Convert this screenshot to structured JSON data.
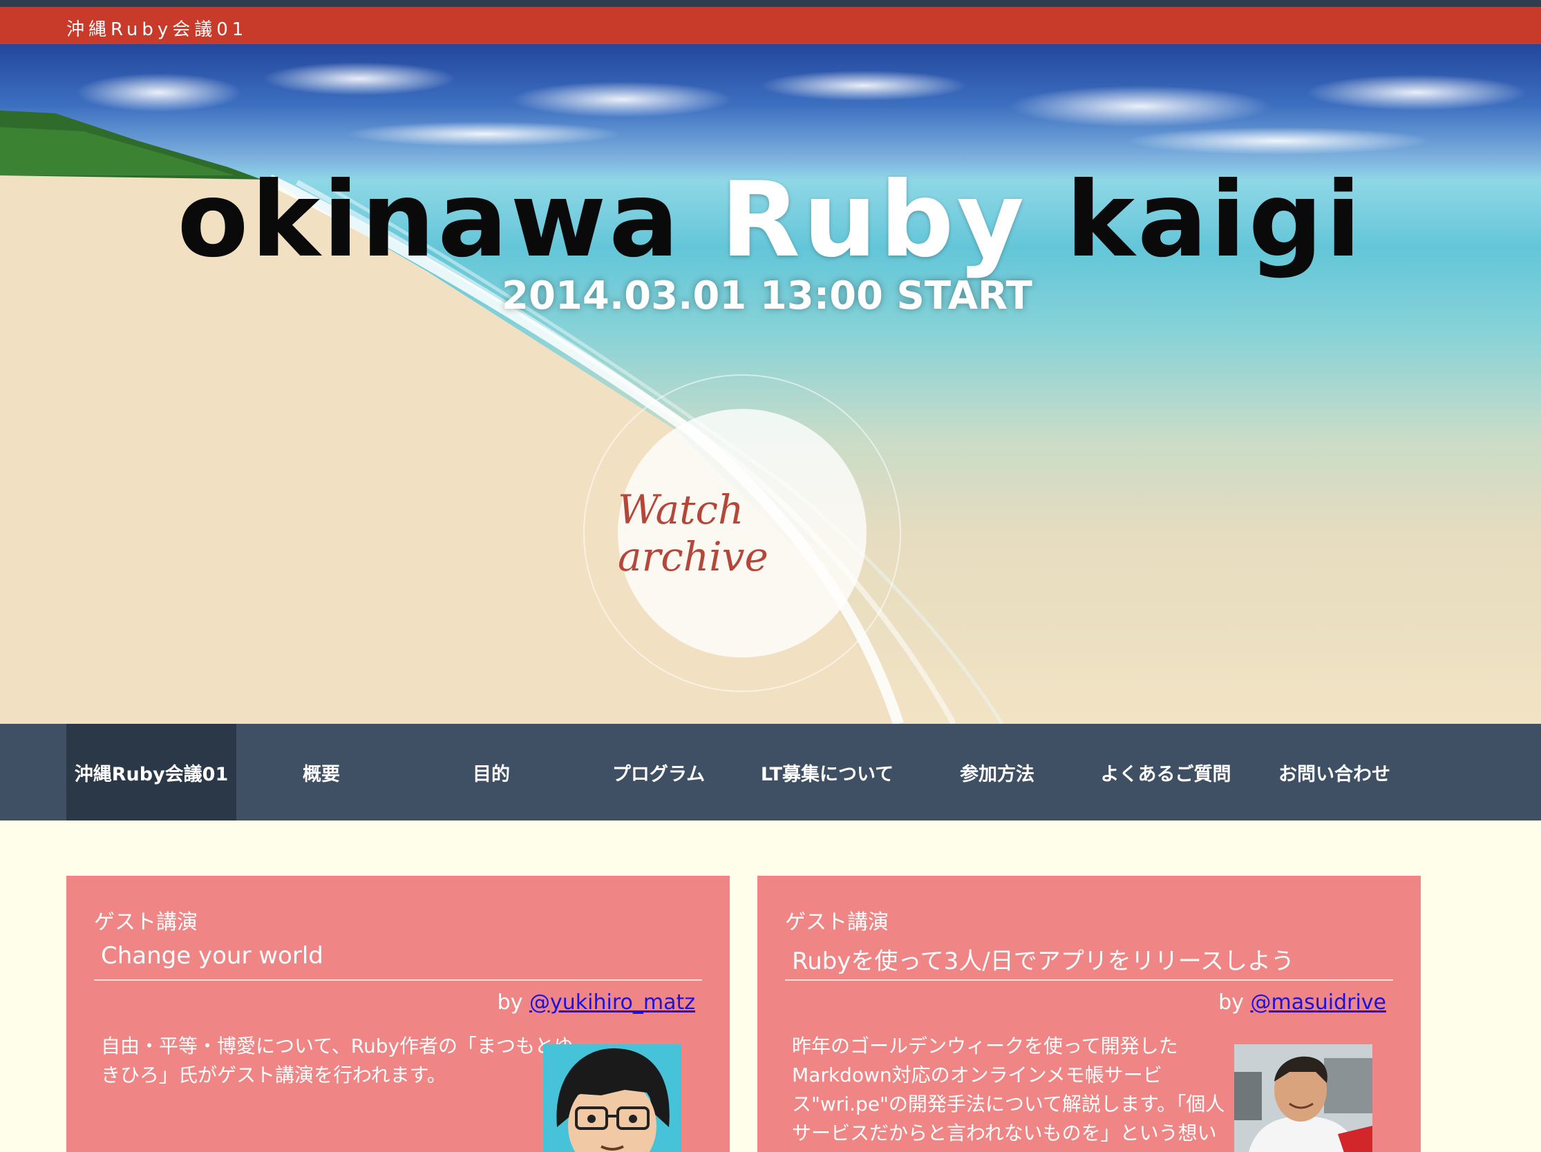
{
  "site": {
    "title": "沖縄Ruby会議01"
  },
  "hero": {
    "title_word1": "okinawa",
    "title_word2": "Ruby",
    "title_word3": "kaigi",
    "date": "2014.03.01 13:00 START",
    "archive_label": "Watch archive"
  },
  "nav": {
    "items": [
      {
        "label": "沖縄Ruby会議01"
      },
      {
        "label": "概要"
      },
      {
        "label": "目的"
      },
      {
        "label": "プログラム"
      },
      {
        "label": "LT募集について"
      },
      {
        "label": "参加方法"
      },
      {
        "label": "よくあるご質問"
      },
      {
        "label": "お問い合わせ"
      }
    ]
  },
  "cards": [
    {
      "tag": "ゲスト講演",
      "title": "Change your world",
      "by_prefix": "by",
      "handle": "@yukihiro_matz",
      "desc_lines": [
        "自由・平等・博愛について、Ruby作者の「まつもとゆ",
        "きひろ」氏がゲスト講演を行われます。"
      ]
    },
    {
      "tag": "ゲスト講演",
      "title": "Rubyを使って3人/日でアプリをリリースしよう",
      "by_prefix": "by",
      "handle": "@masuidrive",
      "desc_lines": [
        "昨年のゴールデンウィークを使って開発した",
        "Markdown対応のオンラインメモ帳サービ",
        "ス\"wri.pe\"の開発手法について解説します。「個人",
        "サービスだからと言われないものを」という想いで"
      ]
    }
  ],
  "colors": {
    "title_bar": "#c83a2a",
    "nav_bg": "#3f5065",
    "nav_active": "#2a3847",
    "card_bg": "#ef8584",
    "page_bg": "#fffeea",
    "link": "#1a10e6"
  }
}
